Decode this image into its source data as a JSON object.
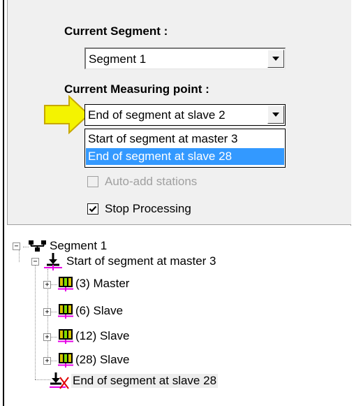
{
  "colors": {
    "panel_bg": "#f0f0f0",
    "selection": "#3399ff",
    "arrow_fill": "#f4f300",
    "arrow_stroke": "#c7a800",
    "tree_icon_magenta": "#e600e6"
  },
  "segment": {
    "label": "Current Segment :",
    "value": "Segment 1"
  },
  "measuring": {
    "label": "Current Measuring point :",
    "value": "End of segment at slave 2",
    "options": [
      "Start of segment at master 3",
      "End of segment at slave 28"
    ],
    "selected_index": 1
  },
  "checkboxes": {
    "auto_add": {
      "label": "Auto-add stations",
      "checked": false,
      "enabled": false
    },
    "stop_processing": {
      "label": "Stop Processing",
      "checked": true,
      "enabled": true
    }
  },
  "tree": {
    "root": {
      "label": "Segment 1",
      "icon": "network-icon"
    },
    "start": {
      "label": "Start of segment at master 3",
      "icon": "measure-start-icon"
    },
    "stations": [
      {
        "label": "(3) Master",
        "icon": "station-icon"
      },
      {
        "label": "(6) Slave",
        "icon": "station-icon"
      },
      {
        "label": "(12) Slave",
        "icon": "station-icon"
      },
      {
        "label": "(28) Slave",
        "icon": "station-icon"
      }
    ],
    "end": {
      "label": "End of segment at slave 28",
      "icon": "measure-end-icon"
    }
  }
}
